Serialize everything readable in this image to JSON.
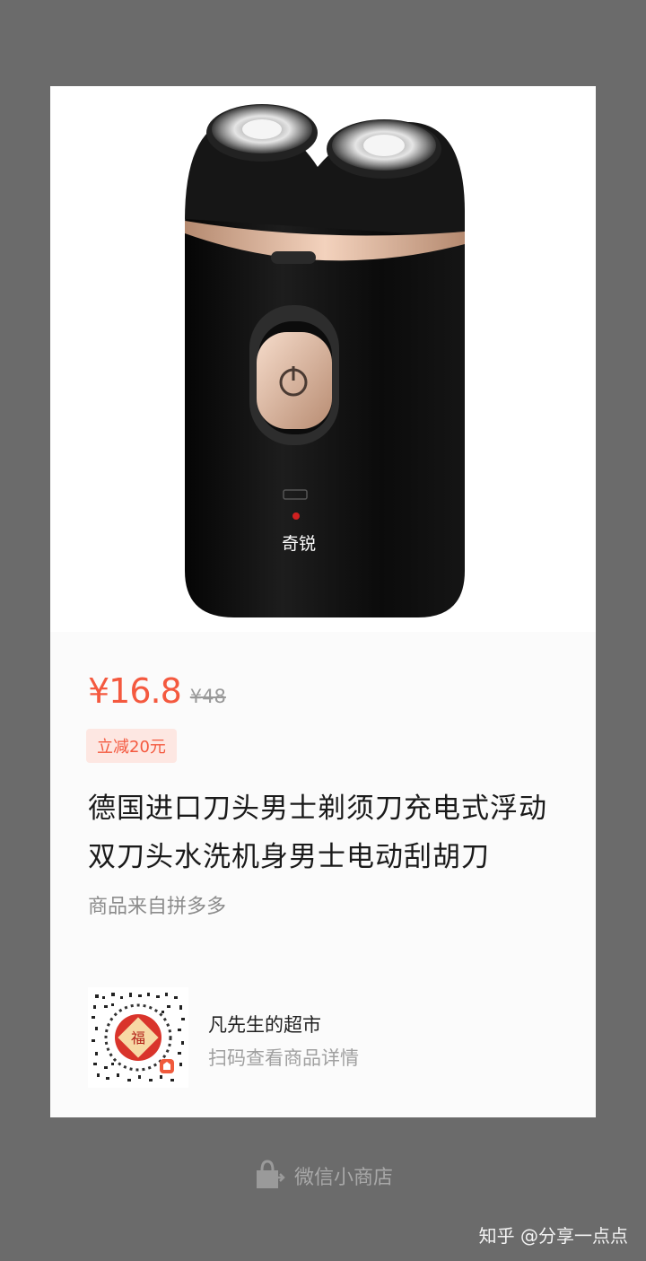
{
  "product": {
    "price_current": "¥16.8",
    "price_original": "¥48",
    "discount_badge": "立减20元",
    "title": "德国进口刀头男士剃须刀充电式浮动双刀头水洗机身男士电动刮胡刀",
    "source": "商品来自拼多多",
    "image_brand_text": "奇锐"
  },
  "shop": {
    "name": "凡先生的超市",
    "scan_hint": "扫码查看商品详情",
    "qr_center_char": "福"
  },
  "footer": {
    "brand_label": "微信小商店",
    "icon": "shopping-bag-icon"
  },
  "watermark": {
    "text": "知乎 @分享一点点"
  },
  "colors": {
    "price": "#f4593f",
    "badge_bg": "#fde7e2",
    "page_bg": "#6b6b6b",
    "card_bg": "#fbfbfb",
    "qr_red": "#d9342b"
  }
}
